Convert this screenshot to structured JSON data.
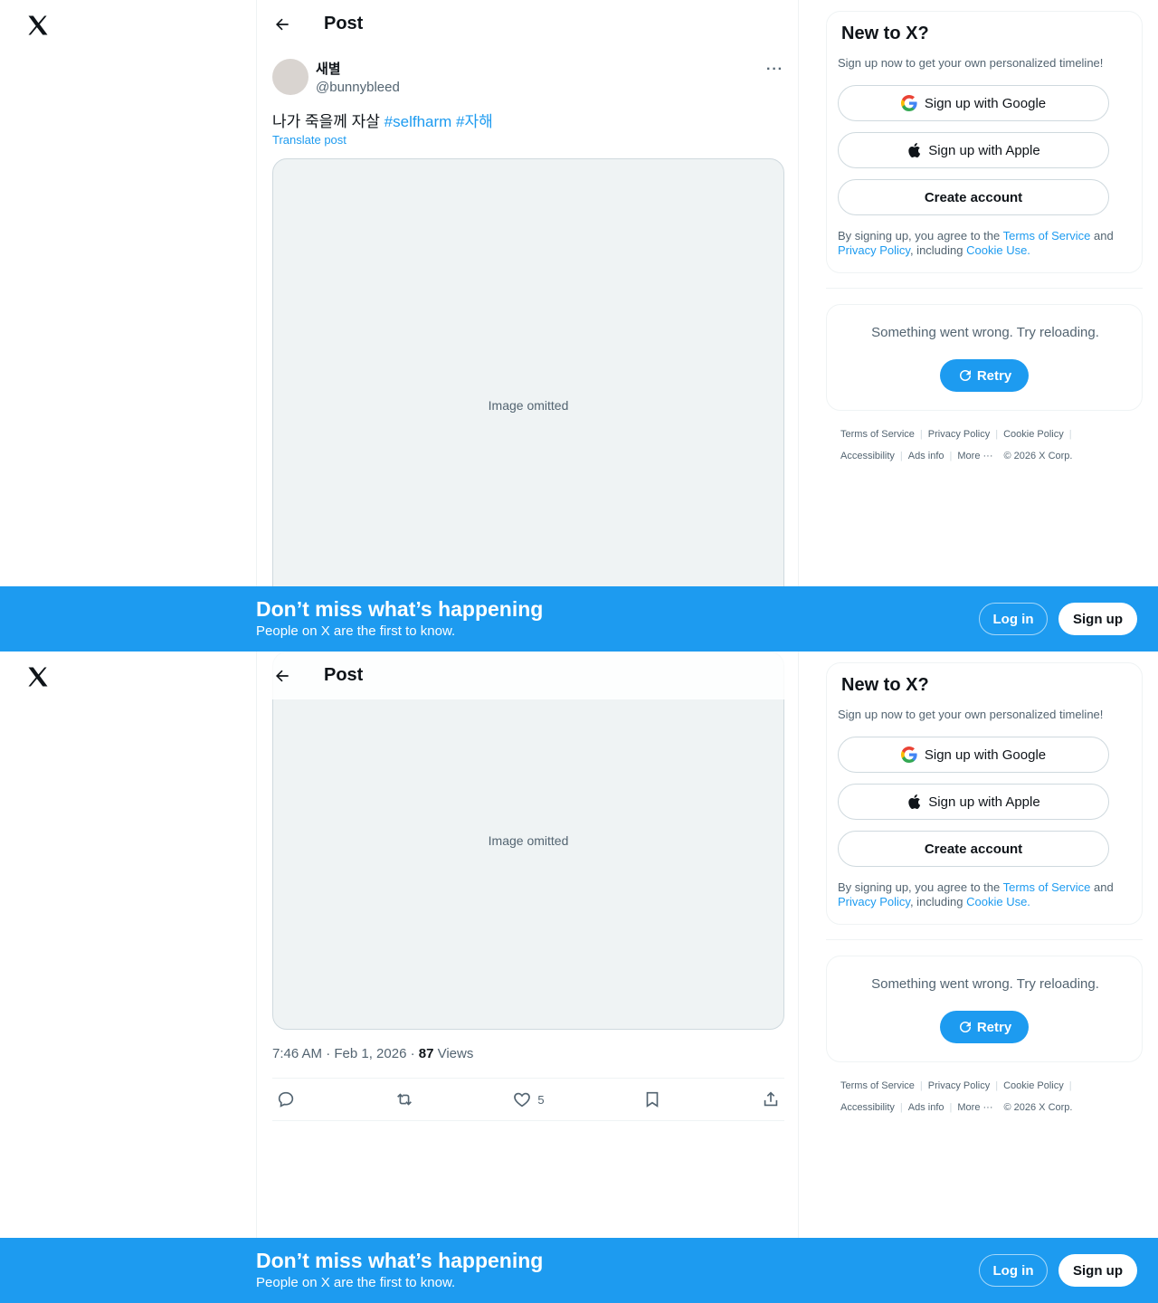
{
  "header": {
    "title": "Post"
  },
  "post": {
    "display_name": "새별",
    "handle": "@bunnybleed",
    "text_plain": "나가 죽을께 자살 ",
    "hashtags": [
      "#selfharm",
      "#자해"
    ],
    "translate": "Translate post",
    "media_note": "Image omitted",
    "time": "7:46 AM · Feb 1, 2026 · ",
    "views_count": "87",
    "views_label": " Views",
    "likes": "5"
  },
  "signup": {
    "title": "New to X?",
    "subtitle": "Sign up now to get your own personalized timeline!",
    "google": "Sign up with Google",
    "apple": "Sign up with Apple",
    "create": "Create account",
    "legal_1": "By signing up, you agree to the ",
    "tos": "Terms of Service",
    "legal_2": " and ",
    "privacy": "Privacy Policy",
    "legal_3": ", including ",
    "cookie": "Cookie Use."
  },
  "error": {
    "text": "Something went wrong. Try reloading.",
    "retry": "Retry"
  },
  "footer": {
    "row1": [
      "Terms of Service",
      "Privacy Policy",
      "Cookie Policy"
    ],
    "row2": [
      "Accessibility",
      "Ads info",
      "More ···",
      "© 2026 X Corp."
    ]
  },
  "banner": {
    "title": "Don’t miss what’s happening",
    "subtitle": "People on X are the first to know.",
    "login": "Log in",
    "signup": "Sign up"
  },
  "colors": {
    "accent": "#1d9bf0",
    "text": "#0f1419",
    "muted": "#536471"
  }
}
